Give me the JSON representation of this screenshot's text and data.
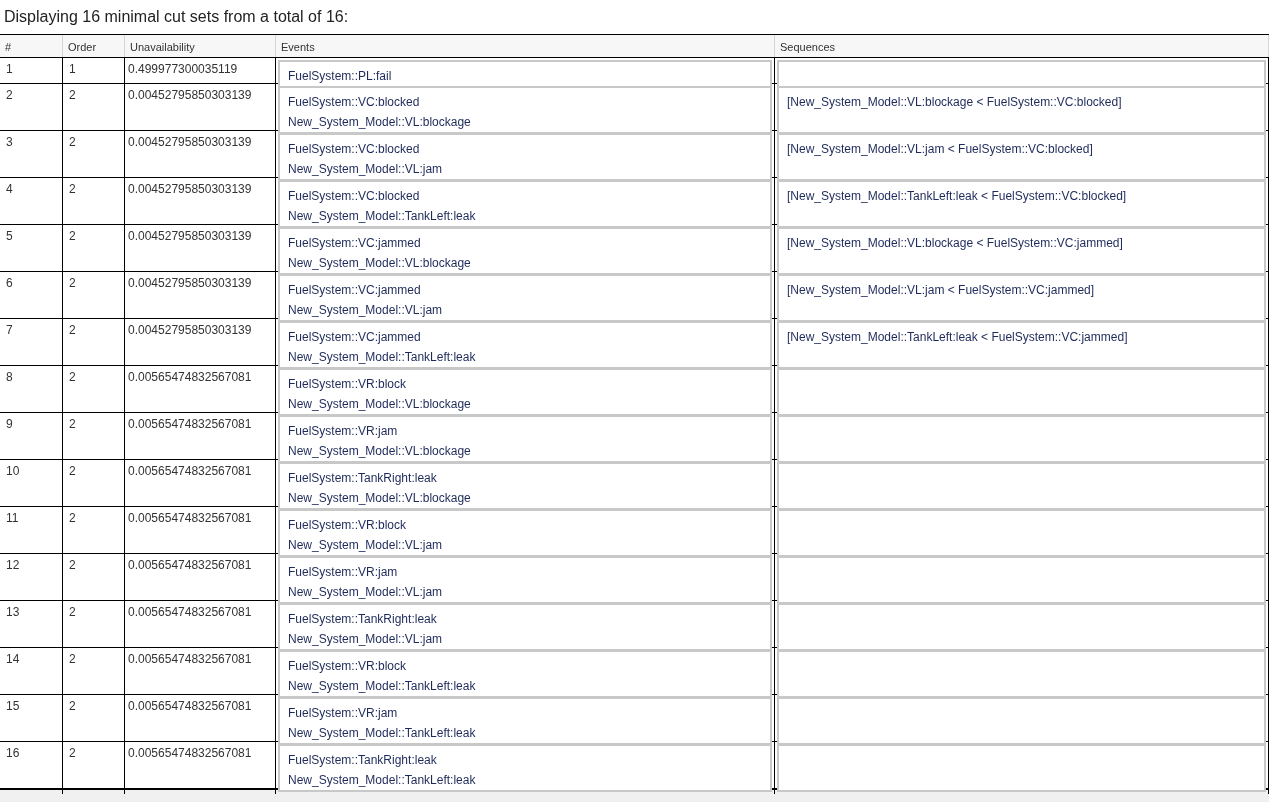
{
  "heading": "Displaying 16 minimal cut sets from a total of 16:",
  "table": {
    "columns": [
      "#",
      "Order",
      "Unavailability",
      "Events",
      "Sequences"
    ],
    "rows": [
      {
        "number": "1",
        "order": "1",
        "unavailability": "0.499977300035119",
        "events": [
          "FuelSystem::PL:fail"
        ],
        "sequences": []
      },
      {
        "number": "2",
        "order": "2",
        "unavailability": "0.00452795850303139",
        "events": [
          "FuelSystem::VC:blocked",
          "New_System_Model::VL:blockage"
        ],
        "sequences": [
          "[New_System_Model::VL:blockage < FuelSystem::VC:blocked]"
        ]
      },
      {
        "number": "3",
        "order": "2",
        "unavailability": "0.00452795850303139",
        "events": [
          "FuelSystem::VC:blocked",
          "New_System_Model::VL:jam"
        ],
        "sequences": [
          "[New_System_Model::VL:jam < FuelSystem::VC:blocked]"
        ]
      },
      {
        "number": "4",
        "order": "2",
        "unavailability": "0.00452795850303139",
        "events": [
          "FuelSystem::VC:blocked",
          "New_System_Model::TankLeft:leak"
        ],
        "sequences": [
          "[New_System_Model::TankLeft:leak < FuelSystem::VC:blocked]"
        ]
      },
      {
        "number": "5",
        "order": "2",
        "unavailability": "0.00452795850303139",
        "events": [
          "FuelSystem::VC:jammed",
          "New_System_Model::VL:blockage"
        ],
        "sequences": [
          "[New_System_Model::VL:blockage < FuelSystem::VC:jammed]"
        ]
      },
      {
        "number": "6",
        "order": "2",
        "unavailability": "0.00452795850303139",
        "events": [
          "FuelSystem::VC:jammed",
          "New_System_Model::VL:jam"
        ],
        "sequences": [
          "[New_System_Model::VL:jam < FuelSystem::VC:jammed]"
        ]
      },
      {
        "number": "7",
        "order": "2",
        "unavailability": "0.00452795850303139",
        "events": [
          "FuelSystem::VC:jammed",
          "New_System_Model::TankLeft:leak"
        ],
        "sequences": [
          "[New_System_Model::TankLeft:leak < FuelSystem::VC:jammed]"
        ]
      },
      {
        "number": "8",
        "order": "2",
        "unavailability": "0.00565474832567081",
        "events": [
          "FuelSystem::VR:block",
          "New_System_Model::VL:blockage"
        ],
        "sequences": []
      },
      {
        "number": "9",
        "order": "2",
        "unavailability": "0.00565474832567081",
        "events": [
          "FuelSystem::VR:jam",
          "New_System_Model::VL:blockage"
        ],
        "sequences": []
      },
      {
        "number": "10",
        "order": "2",
        "unavailability": "0.00565474832567081",
        "events": [
          "FuelSystem::TankRight:leak",
          "New_System_Model::VL:blockage"
        ],
        "sequences": []
      },
      {
        "number": "11",
        "order": "2",
        "unavailability": "0.00565474832567081",
        "events": [
          "FuelSystem::VR:block",
          "New_System_Model::VL:jam"
        ],
        "sequences": []
      },
      {
        "number": "12",
        "order": "2",
        "unavailability": "0.00565474832567081",
        "events": [
          "FuelSystem::VR:jam",
          "New_System_Model::VL:jam"
        ],
        "sequences": []
      },
      {
        "number": "13",
        "order": "2",
        "unavailability": "0.00565474832567081",
        "events": [
          "FuelSystem::TankRight:leak",
          "New_System_Model::VL:jam"
        ],
        "sequences": []
      },
      {
        "number": "14",
        "order": "2",
        "unavailability": "0.00565474832567081",
        "events": [
          "FuelSystem::VR:block",
          "New_System_Model::TankLeft:leak"
        ],
        "sequences": []
      },
      {
        "number": "15",
        "order": "2",
        "unavailability": "0.00565474832567081",
        "events": [
          "FuelSystem::VR:jam",
          "New_System_Model::TankLeft:leak"
        ],
        "sequences": []
      },
      {
        "number": "16",
        "order": "2",
        "unavailability": "0.00565474832567081",
        "events": [
          "FuelSystem::TankRight:leak",
          "New_System_Model::TankLeft:leak"
        ],
        "sequences": []
      }
    ]
  }
}
